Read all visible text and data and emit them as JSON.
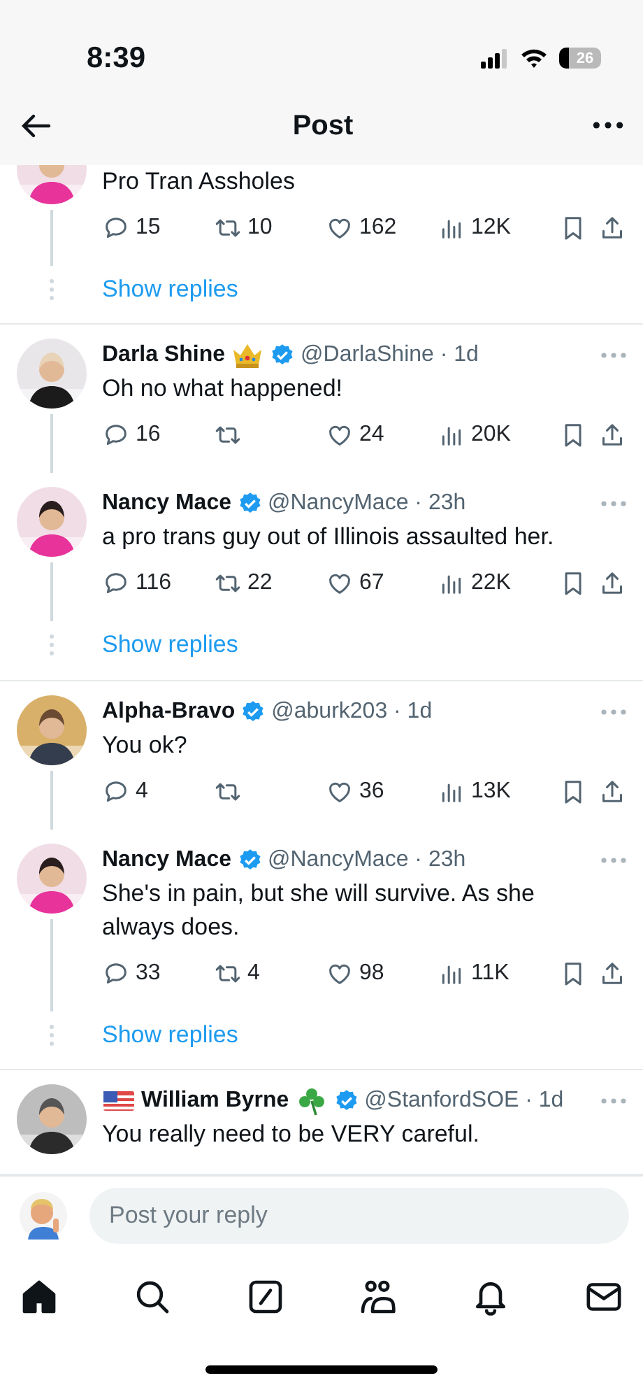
{
  "status_bar": {
    "time": "8:39",
    "battery": "26"
  },
  "header": {
    "title": "Post"
  },
  "threads": [
    {
      "tweets": [
        {
          "partial": true,
          "text": "Pro Tran Assholes",
          "replies": "15",
          "reposts": "10",
          "likes": "162",
          "views": "12K"
        }
      ],
      "show_replies": "Show replies"
    },
    {
      "tweets": [
        {
          "name": "Darla Shine",
          "badges_after": [
            {
              "kind": "crown"
            }
          ],
          "verified": true,
          "meta": "@DarlaShine · 1d",
          "text": "Oh no what happened!",
          "replies": "16",
          "likes": "24",
          "views": "20K"
        },
        {
          "name": "Nancy Mace",
          "verified": true,
          "meta": "@NancyMace · 23h",
          "text": "a pro trans guy out of Illinois assaulted her.",
          "replies": "116",
          "reposts": "22",
          "likes": "67",
          "views": "22K"
        }
      ],
      "show_replies": "Show replies"
    },
    {
      "tweets": [
        {
          "name": "Alpha-Bravo",
          "verified": true,
          "meta": "@aburk203 · 1d",
          "text": "You ok?",
          "replies": "4",
          "likes": "36",
          "views": "13K"
        },
        {
          "name": "Nancy Mace",
          "verified": true,
          "meta": "@NancyMace · 23h",
          "text": "She's in pain, but she will survive. As she always does.",
          "replies": "33",
          "reposts": "4",
          "likes": "98",
          "views": "11K"
        }
      ],
      "show_replies": "Show replies"
    },
    {
      "tweets": [
        {
          "name": "William Byrne",
          "badges_before": [
            {
              "kind": "flag"
            }
          ],
          "badges_after": [
            {
              "kind": "shamrock"
            }
          ],
          "verified": true,
          "meta": "@StanfordSOE · 1d",
          "text": "You really need to be VERY careful."
        }
      ]
    }
  ],
  "reply_box": {
    "placeholder": "Post your reply"
  },
  "tab_bar": [
    {
      "kind": "home",
      "selected": true
    },
    {
      "kind": "search",
      "selected": false
    },
    {
      "kind": "compose",
      "selected": false
    },
    {
      "kind": "communities",
      "selected": false
    },
    {
      "kind": "notifications",
      "selected": false
    },
    {
      "kind": "messages",
      "selected": false
    }
  ]
}
